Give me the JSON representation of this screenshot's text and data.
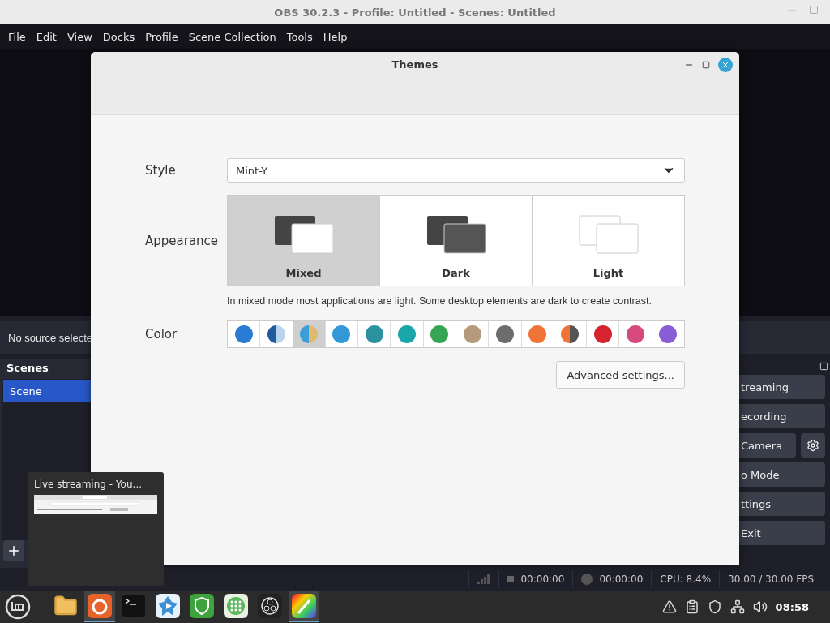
{
  "obs": {
    "title": "OBS 30.2.3 - Profile: Untitled - Scenes: Untitled",
    "menu": [
      "File",
      "Edit",
      "View",
      "Docks",
      "Profile",
      "Scene Collection",
      "Tools",
      "Help"
    ],
    "source_bar": "No source selecte",
    "scenes": {
      "title": "Scenes",
      "items": [
        {
          "label": "Scene",
          "selected": true
        }
      ]
    },
    "controls": [
      {
        "label": "treaming",
        "kind": "plain"
      },
      {
        "label": "ecording",
        "kind": "plain"
      },
      {
        "label": "Camera",
        "kind": "gear"
      },
      {
        "label": "o Mode",
        "kind": "plain"
      },
      {
        "label": "ttings",
        "kind": "plain"
      },
      {
        "label": "Exit",
        "kind": "plain"
      }
    ],
    "status": {
      "stream_time": "00:00:00",
      "record_time": "00:00:00",
      "cpu": "CPU: 8.4%",
      "fps": "30.00 / 30.00 FPS"
    }
  },
  "dialog": {
    "title": "Themes",
    "style": {
      "label": "Style",
      "value": "Mint-Y"
    },
    "appearance": {
      "label": "Appearance",
      "options": [
        {
          "label": "Mixed",
          "kind": "mixed",
          "selected": true
        },
        {
          "label": "Dark",
          "kind": "dark",
          "selected": false
        },
        {
          "label": "Light",
          "kind": "light",
          "selected": false
        }
      ],
      "description": "In mixed mode most applications are light. Some desktop elements are dark to create contrast."
    },
    "color": {
      "label": "Color",
      "swatches": [
        {
          "color": "#2a7bd4",
          "selected": false
        },
        {
          "halves": [
            {
              "color": "#1e5a9c"
            },
            {
              "color": "#b8d4ee"
            }
          ],
          "selected": false
        },
        {
          "halves": [
            {
              "color": "#3a9fd8"
            },
            {
              "color": "#e0bb6e"
            }
          ],
          "selected": true
        },
        {
          "color": "#3498d6",
          "selected": false
        },
        {
          "color": "#2a929e",
          "selected": false
        },
        {
          "color": "#1aa5aa",
          "selected": false
        },
        {
          "color": "#35a453",
          "selected": false
        },
        {
          "color": "#b59a7c",
          "selected": false
        },
        {
          "color": "#6d6d6d",
          "selected": false
        },
        {
          "color": "#f07438",
          "selected": false
        },
        {
          "halves": [
            {
              "color": "#f07438"
            },
            {
              "color": "#555555"
            }
          ],
          "selected": false
        },
        {
          "color": "#d6232e",
          "selected": false
        },
        {
          "color": "#d64a7e",
          "selected": false
        },
        {
          "color": "#8a5cd6",
          "selected": false
        }
      ]
    },
    "advanced": "Advanced settings..."
  },
  "popup": {
    "title": "Live streaming - You..."
  },
  "taskbar": {
    "apps": [
      {
        "kind": "folder",
        "active": false
      },
      {
        "kind": "firefox",
        "active": true
      },
      {
        "kind": "terminal",
        "active": false
      },
      {
        "kind": "blue",
        "active": false
      },
      {
        "kind": "shield",
        "active": false
      },
      {
        "kind": "grid",
        "active": false
      },
      {
        "kind": "obs",
        "active": false
      },
      {
        "kind": "paint",
        "active": true
      }
    ],
    "clock": "08:58"
  }
}
